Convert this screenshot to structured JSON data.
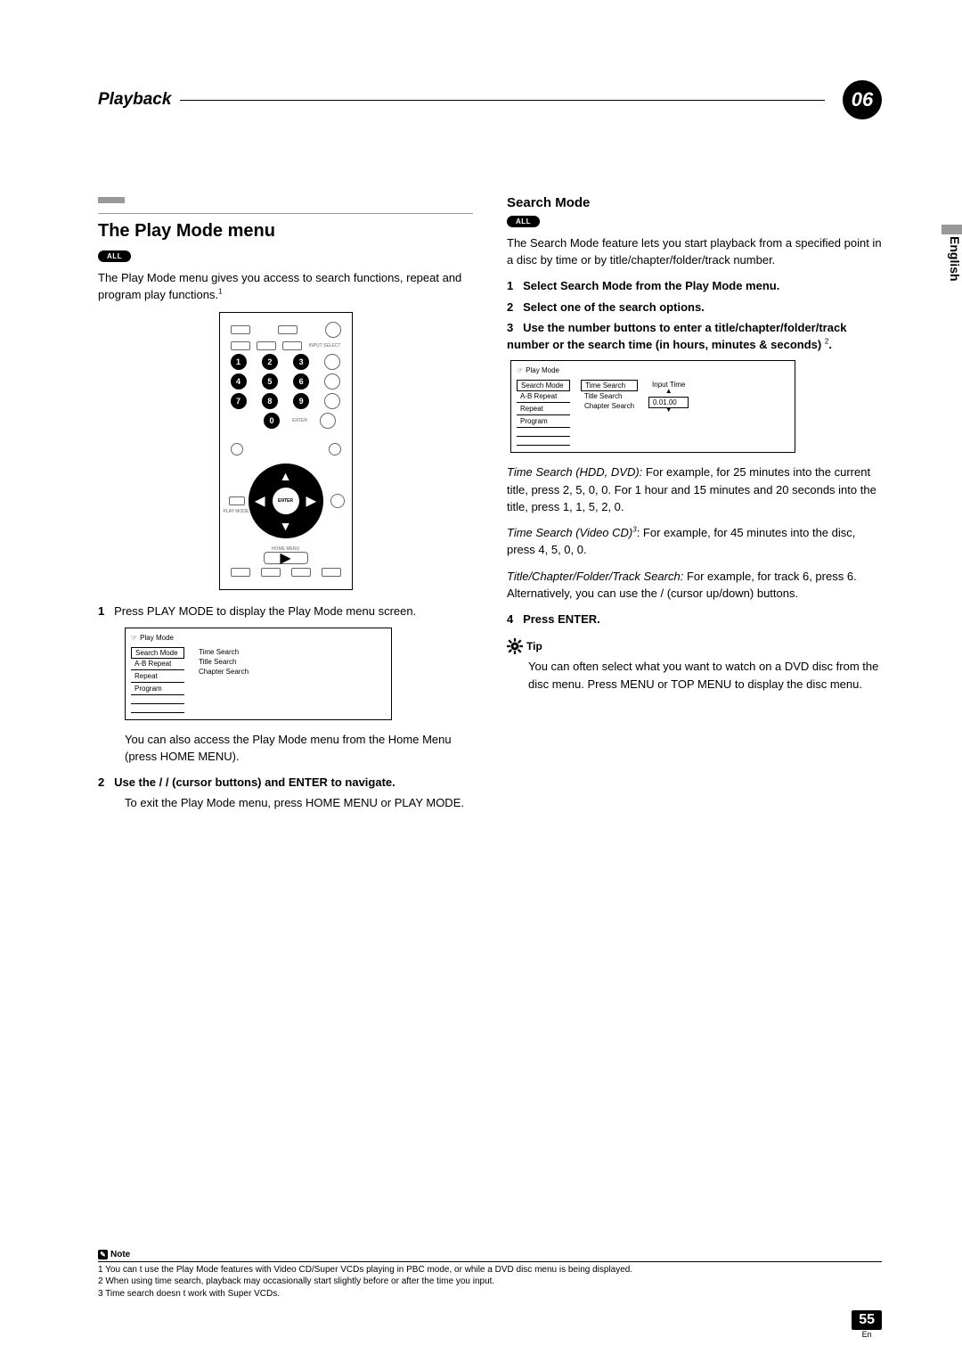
{
  "header": {
    "title": "Playback",
    "chapter": "06"
  },
  "sideTab": "English",
  "left": {
    "heading": "The Play Mode menu",
    "badge": "ALL",
    "intro": "The Play Mode menu gives you access to search functions, repeat and program play functions.",
    "introSup": "1",
    "remote": {
      "num1": "1",
      "num2": "2",
      "num3": "3",
      "num4": "4",
      "num5": "5",
      "num6": "6",
      "num7": "7",
      "num8": "8",
      "num9": "9",
      "num0": "0",
      "enter": "ENTER",
      "playmode": "PLAY MODE",
      "homemenu": "HOME MENU"
    },
    "step1Num": "1",
    "step1": "Press PLAY MODE to display the Play Mode menu screen.",
    "menu": {
      "title": "Play Mode",
      "left": {
        "a": "Search Mode",
        "b": "A-B Repeat",
        "c": "Repeat",
        "d": "Program"
      },
      "right": {
        "a": "Time Search",
        "b": "Title Search",
        "c": "Chapter Search"
      }
    },
    "accessText": "You can also access the Play Mode menu from the Home Menu (press HOME MENU).",
    "step2Num": "2",
    "step2a": "Use the ",
    "step2b": " / ",
    "step2c": " / ",
    "step2d": " (cursor buttons) and ENTER to navigate.",
    "step2exit": "To exit the Play Mode menu, press HOME MENU or PLAY MODE."
  },
  "right": {
    "heading": "Search Mode",
    "badge": "ALL",
    "intro": "The Search Mode feature lets you start playback from a specified point in a disc by time or by title/chapter/folder/track number.",
    "step1Num": "1",
    "step1": "Select  Search Mode  from the Play Mode menu.",
    "step2Num": "2",
    "step2": "Select one of the search options.",
    "step3Num": "3",
    "step3": "Use the number buttons to enter a title/chapter/folder/track number or the search time (in hours, minutes & seconds) ",
    "step3Sup": "2",
    "step3End": ".",
    "menu": {
      "title": "Play Mode",
      "left": {
        "a": "Search Mode",
        "b": "A-B Repeat",
        "c": "Repeat",
        "d": "Program"
      },
      "right": {
        "a": "Time Search",
        "b": "Title Search",
        "c": "Chapter Search"
      },
      "inputLabel": "Input Time",
      "inputValue": "0.01.00"
    },
    "ts1Label": "Time Search (HDD, DVD):",
    "ts1": " For example, for 25 minutes into the current title, press 2, 5, 0, 0. For 1 hour and 15 minutes and 20 seconds into the title, press 1, 1, 5, 2, 0.",
    "ts2Label": "Time Search (Video CD)",
    "ts2Sup": "3",
    "ts2": ": For example, for 45 minutes into the disc, press 4, 5, 0, 0.",
    "ts3Label": "Title/Chapter/Folder/Track Search:",
    "ts3": " For example, for track 6, press 6. Alternatively, you can use the   /   (cursor up/down) buttons.",
    "step4Num": "4",
    "step4": "Press ENTER.",
    "tipLabel": "Tip",
    "tipText": "You can often select what you want to watch on a DVD disc from the disc menu. Press MENU or TOP MENU to display the disc menu."
  },
  "footer": {
    "noteLabel": "Note",
    "n1": "1 You can t use the Play Mode features with Video CD/Super VCDs playing in PBC mode, or while a DVD disc menu is being displayed.",
    "n2": "2 When using time search, playback may occasionally start slightly before or after the time you input.",
    "n3": "3 Time search doesn t work with Super VCDs.",
    "pageNum": "55",
    "lang": "En"
  }
}
